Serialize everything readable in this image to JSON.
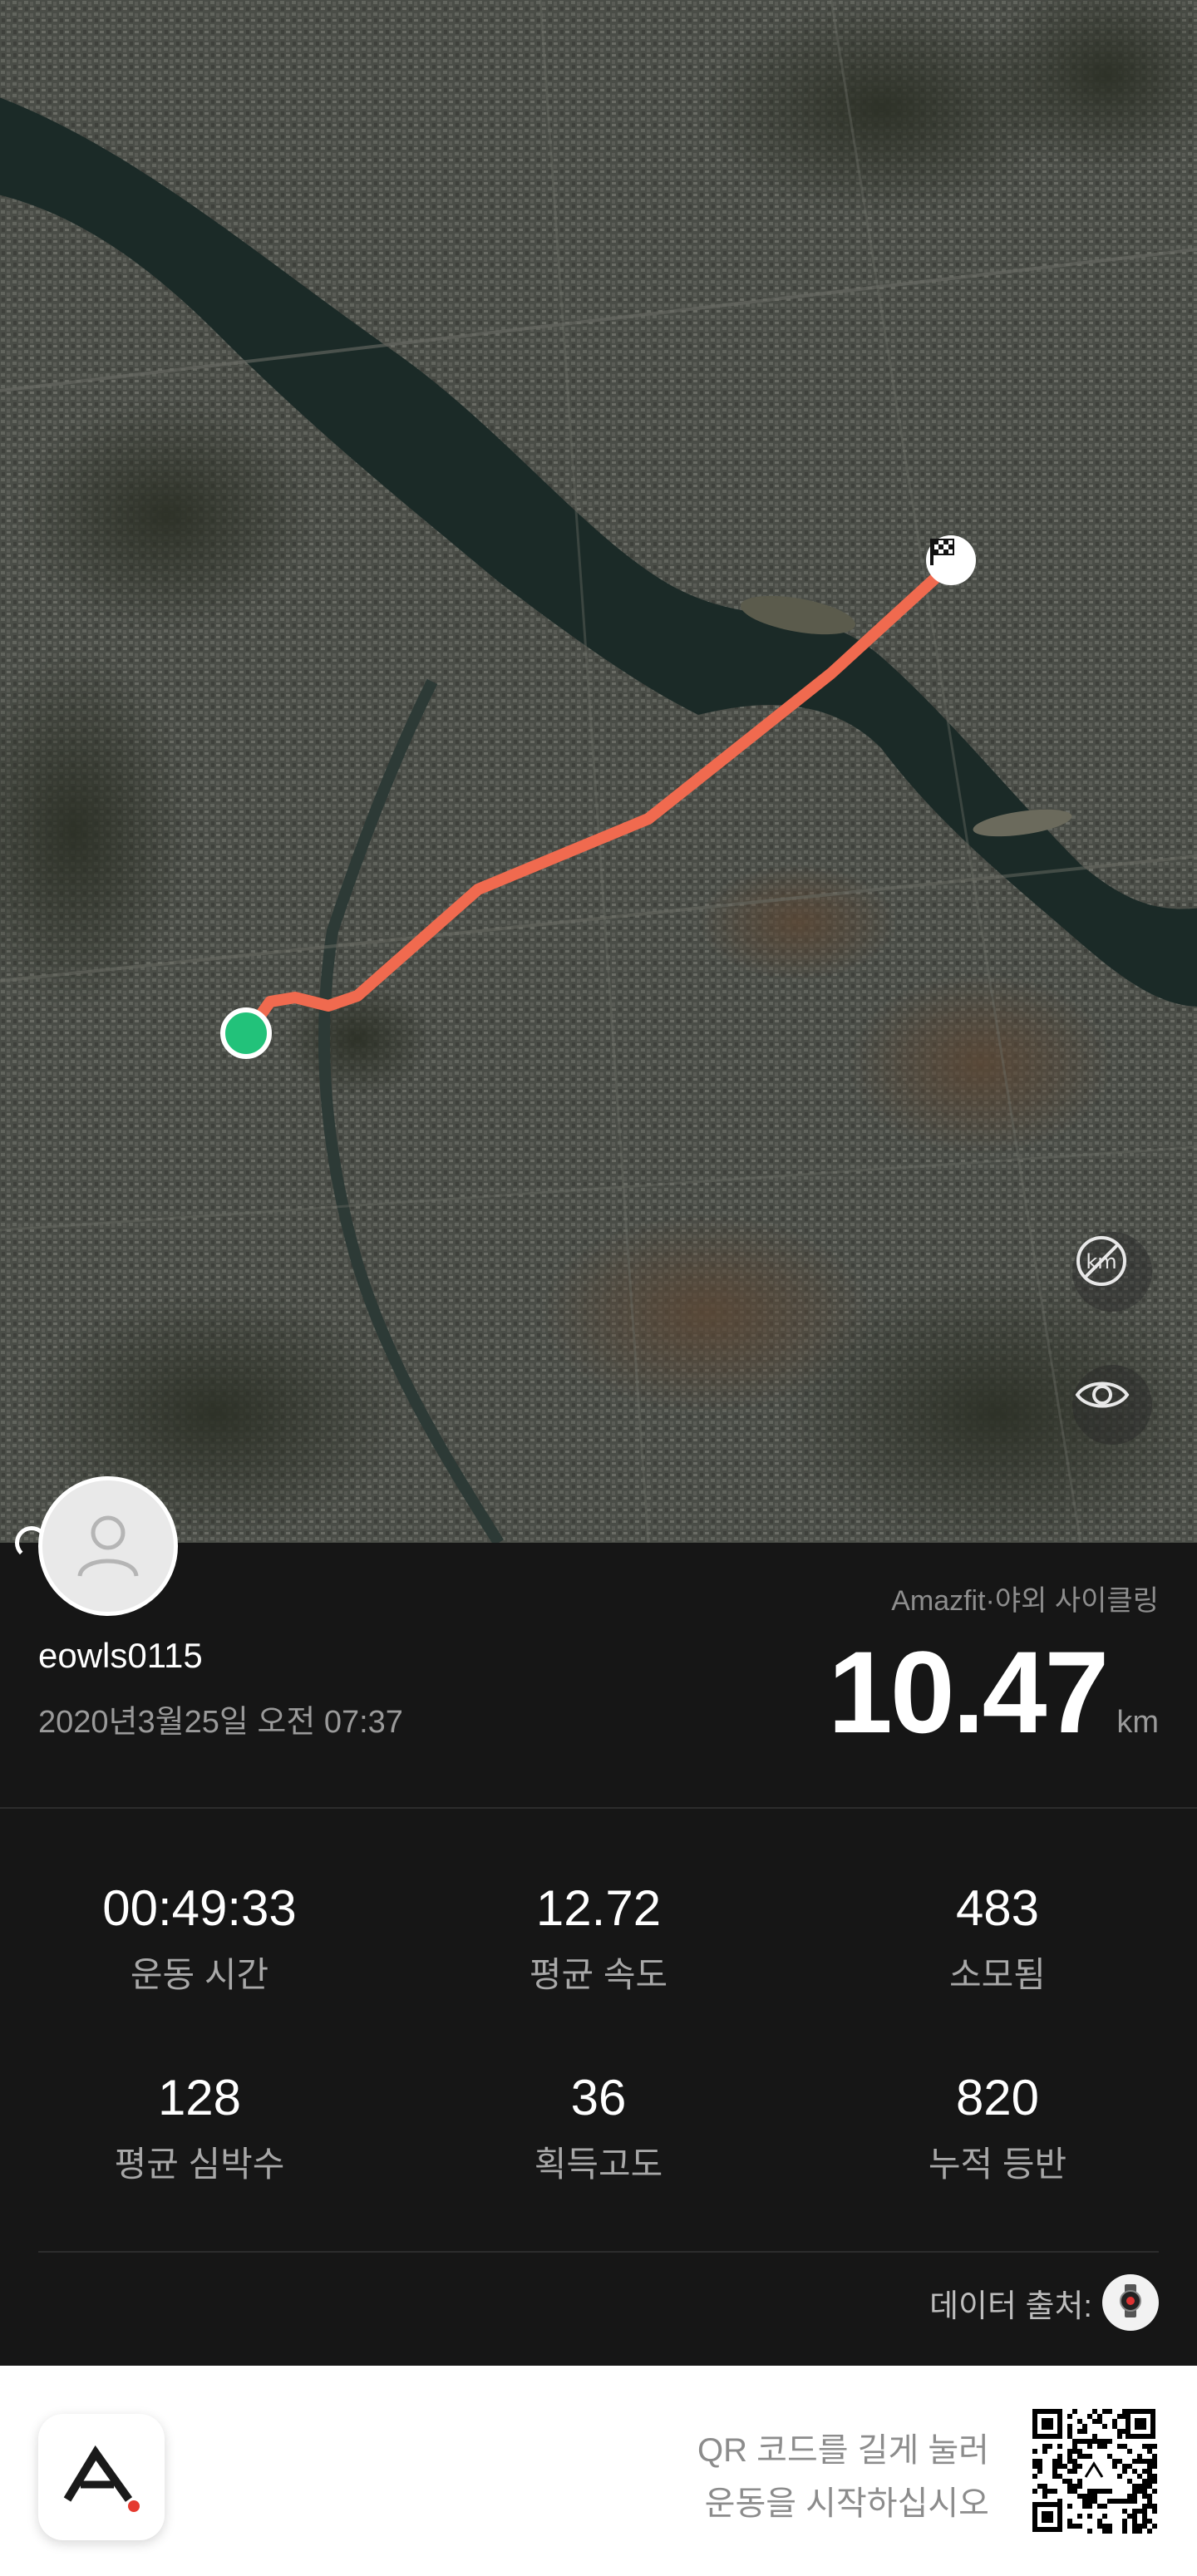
{
  "map": {
    "unit_toggle_icon": "km-off-icon",
    "visibility_icon": "eye-icon",
    "start_marker_color": "#22c27a",
    "route_color": "#f06a4f",
    "finish_icon": "checkered-flag-icon"
  },
  "profile": {
    "username": "eowls0115",
    "datetime": "2020년3월25일 오전 07:37",
    "avatar_icon": "user-placeholder-icon"
  },
  "activity": {
    "type": "Amazfit·야외 사이클링",
    "distance": "10.47",
    "distance_unit": "km"
  },
  "stats": [
    {
      "value": "00:49:33",
      "label": "운동 시간"
    },
    {
      "value": "12.72",
      "label": "평균 속도"
    },
    {
      "value": "483",
      "label": "소모됨"
    },
    {
      "value": "128",
      "label": "평균 심박수"
    },
    {
      "value": "36",
      "label": "획득고도"
    },
    {
      "value": "820",
      "label": "누적 등반"
    }
  ],
  "source": {
    "label": "데이터 출처:",
    "device_icon": "smartwatch-icon"
  },
  "footer": {
    "app_icon": "amazfit-logo-icon",
    "qr_line1": "QR 코드를 길게 눌러",
    "qr_line2": "운동을 시작하십시오",
    "qr_icon": "qr-code-icon",
    "accent_color": "#e53a2f"
  }
}
